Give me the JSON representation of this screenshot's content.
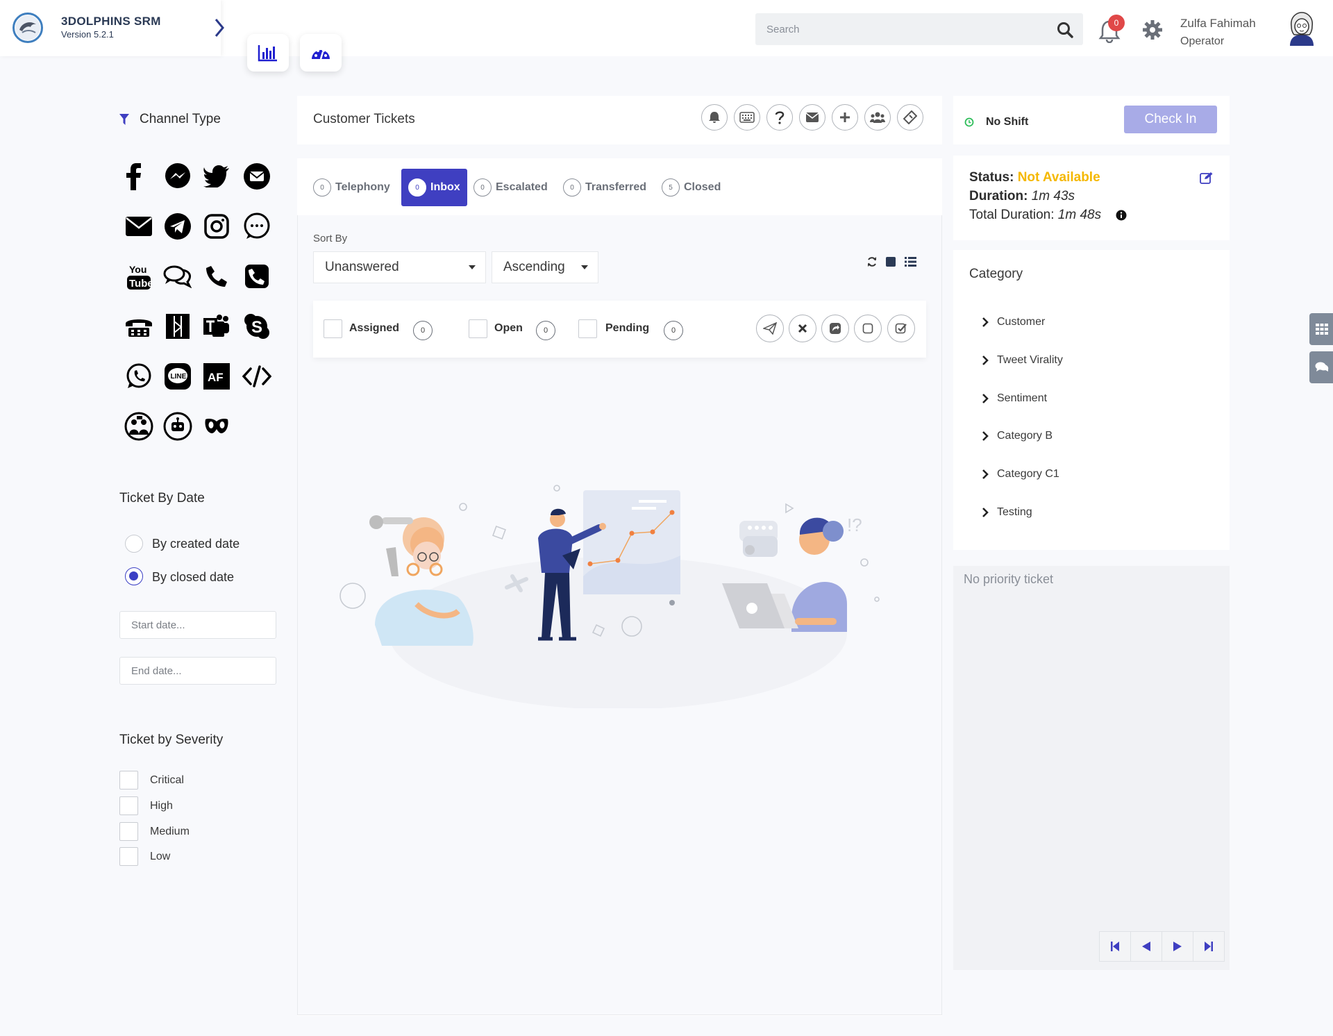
{
  "header": {
    "app_name": "3DOLPHINS SRM",
    "version": "Version 5.2.1",
    "search_placeholder": "Search",
    "notification_count": "0",
    "user_name": "Zulfa Fahimah",
    "user_role": "Operator"
  },
  "left_panel": {
    "channel_type_title": "Channel Type",
    "channels": [
      "facebook-icon",
      "messenger-icon",
      "twitter-icon",
      "email-circle-icon",
      "email-icon",
      "telegram-icon",
      "instagram-icon",
      "chat-bubble-icon",
      "youtube-icon",
      "comments-icon",
      "phone-icon",
      "phone-square-icon",
      "fax-icon",
      "zalo-icon",
      "teams-icon",
      "skype-icon",
      "whatsapp-icon",
      "line-icon",
      "af-icon",
      "code-icon",
      "group-chat-icon",
      "bot-icon",
      "mask-icon"
    ],
    "ticket_by_date_title": "Ticket By Date",
    "date_options": [
      "By created date",
      "By closed date"
    ],
    "selected_date_option": "By closed date",
    "start_date_placeholder": "Start date...",
    "end_date_placeholder": "End date...",
    "severity_title": "Ticket by Severity",
    "severities": [
      "Critical",
      "High",
      "Medium",
      "Low"
    ]
  },
  "center": {
    "title": "Customer Tickets",
    "tabs": [
      {
        "label": "Telephony",
        "count": "0"
      },
      {
        "label": "Inbox",
        "count": "0"
      },
      {
        "label": "Escalated",
        "count": "0"
      },
      {
        "label": "Transferred",
        "count": "0"
      },
      {
        "label": "Closed",
        "count": "5"
      }
    ],
    "active_tab": "Inbox",
    "sort_by_label": "Sort By",
    "sort_field": "Unanswered",
    "sort_order": "Ascending",
    "filters": [
      {
        "label": "Assigned",
        "count": "0"
      },
      {
        "label": "Open",
        "count": "0"
      },
      {
        "label": "Pending",
        "count": "0"
      }
    ]
  },
  "right_panel": {
    "shift_label": "No Shift",
    "check_in_label": "Check In",
    "status_label": "Status:",
    "status_value": "Not Available",
    "duration_label": "Duration:",
    "duration_value": "1m 43s",
    "total_duration_label": "Total Duration:",
    "total_duration_value": "1m 48s",
    "category_title": "Category",
    "categories": [
      "Customer",
      "Tweet Virality",
      "Sentiment",
      "Category B",
      "Category C1",
      "Testing"
    ],
    "priority_text": "No priority ticket"
  },
  "colors": {
    "accent": "#3f3fc1",
    "status_warning": "#f5b800",
    "badge": "#e04848"
  }
}
